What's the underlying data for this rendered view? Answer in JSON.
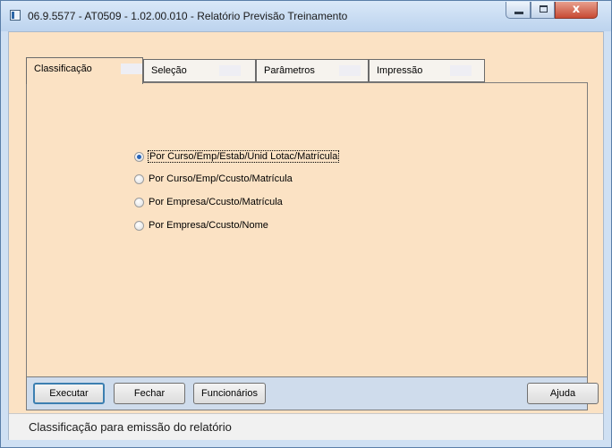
{
  "window": {
    "title": "06.9.5577 - AT0509 - 1.02.00.010 - Relatório Previsão Treinamento",
    "controls": {
      "minimize": "",
      "maximize": "",
      "close": "x"
    }
  },
  "tabs": [
    {
      "label": "Classificação",
      "active": true
    },
    {
      "label": "Seleção",
      "active": false
    },
    {
      "label": "Parâmetros",
      "active": false
    },
    {
      "label": "Impressão",
      "active": false
    }
  ],
  "classificacao": {
    "options": [
      {
        "label": "Por Curso/Emp/Estab/Unid Lotac/Matrícula",
        "checked": true
      },
      {
        "label": "Por Curso/Emp/Ccusto/Matrícula",
        "checked": false
      },
      {
        "label": "Por Empresa/Ccusto/Matrícula",
        "checked": false
      },
      {
        "label": "Por Empresa/Ccusto/Nome",
        "checked": false
      }
    ]
  },
  "buttons": {
    "executar": "Executar",
    "fechar": "Fechar",
    "funcionarios": "Funcionários",
    "ajuda": "Ajuda"
  },
  "status_bar": {
    "text": "Classificação para emissão do relatório"
  },
  "colors": {
    "panel_bg": "#fbe2c4",
    "button_bar_bg": "#cfdcec",
    "selected_radio": "#2663b8",
    "close_button": "#c74a34"
  },
  "icons": {
    "app": "window-app-icon",
    "minimize": "minimize-icon",
    "maximize": "maximize-icon",
    "close": "close-icon"
  }
}
